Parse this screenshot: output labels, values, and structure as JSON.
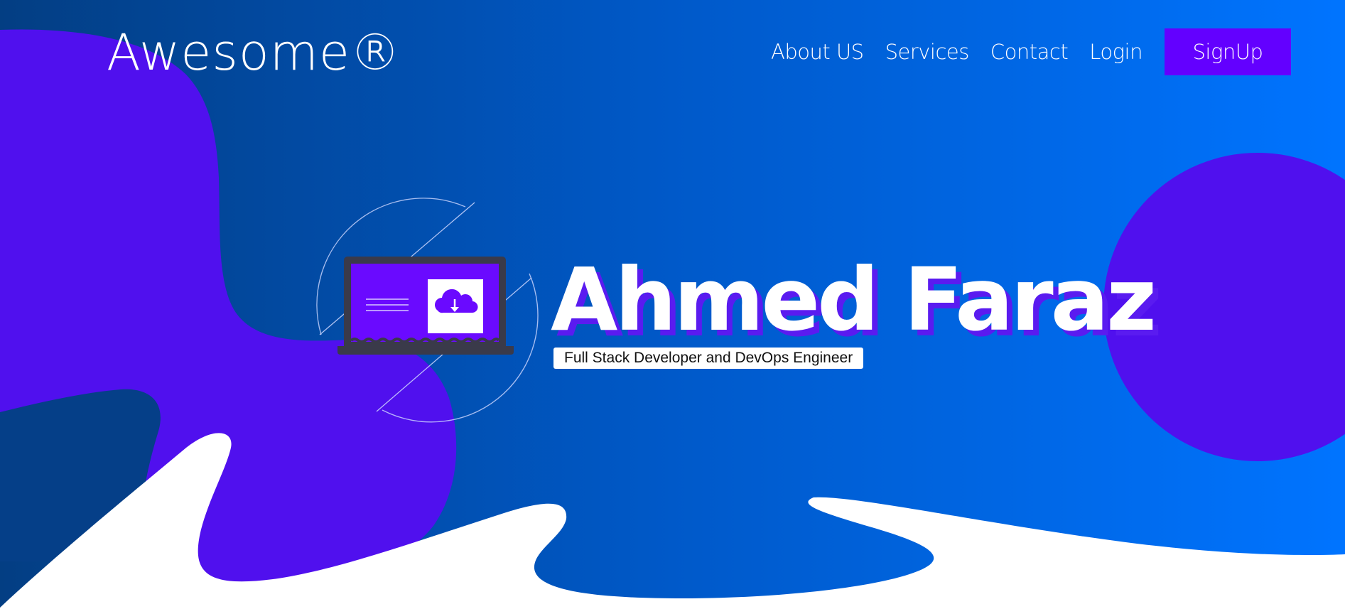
{
  "brand": {
    "logo_text": "Awesome®"
  },
  "nav": {
    "links": [
      "About US",
      "Services",
      "Contact",
      "Login"
    ],
    "signup_label": "SignUp"
  },
  "hero": {
    "name": "Ahmed Faraz",
    "tagline": "Full Stack Developer and DevOps Engineer"
  },
  "illustration": {
    "icon": "laptop-cloud-download-icon"
  },
  "colors": {
    "gradient_start": "#033e83",
    "gradient_end": "#0074ff",
    "purple_accent": "#5a10ee",
    "signup_bg": "#6300ff",
    "wave": "#ffffff"
  }
}
